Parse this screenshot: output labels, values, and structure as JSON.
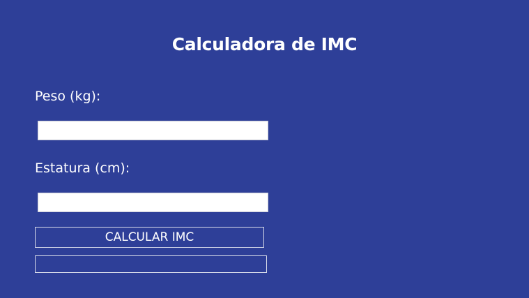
{
  "app": {
    "title": "Calculadora de IMC"
  },
  "form": {
    "peso": {
      "label": "Peso (kg):",
      "value": "",
      "placeholder": ""
    },
    "estatura": {
      "label": "Estatura (cm):",
      "value": "",
      "placeholder": ""
    },
    "calculate_button_label": "CALCULAR IMC",
    "result_text": ""
  },
  "colors": {
    "background": "#2e3f98",
    "text": "#ffffff",
    "field_background": "#ffffff",
    "border": "#d9dcea"
  }
}
